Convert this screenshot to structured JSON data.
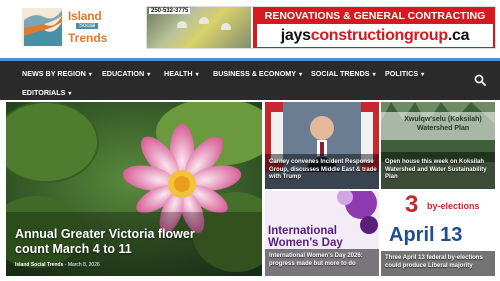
{
  "logo": {
    "word1": "Island",
    "word2": "Social",
    "word3": "Trends"
  },
  "ad": {
    "phone": "250-532-3775",
    "line1": "RENOVATIONS & GENERAL CONTRACTING",
    "domain_part1": "jays",
    "domain_part2": "constructiongroup",
    "domain_part3": ".ca"
  },
  "nav": {
    "items": [
      {
        "label": "NEWS BY REGION"
      },
      {
        "label": "EDUCATION"
      },
      {
        "label": "HEALTH"
      },
      {
        "label": "BUSINESS & ECONOMY"
      },
      {
        "label": "SOCIAL TRENDS"
      },
      {
        "label": "POLITICS"
      },
      {
        "label": "EDITORIALS"
      }
    ],
    "search_icon": "search-icon",
    "accent": "#4a90d9"
  },
  "hero": {
    "title": "Annual Greater Victoria flower count March 4 to 11",
    "author": "Island Social Trends",
    "separator": "-",
    "date": "March 8, 2026"
  },
  "cards": [
    {
      "title": "Carney convenes Incident Response Group, discusses Middle East & trade with Trump"
    },
    {
      "title": "Open house this week on Koksilah Watershed and Water Sustainability Plan",
      "image_text": "Xwulqw'selu (Koksilah) Watershed Plan"
    },
    {
      "title": "International Women's Day 2026: progress made but more to do",
      "image_text_1": "International",
      "image_text_2": "Women's Day"
    },
    {
      "title": "Three April 13 federal by-elections could produce Liberal majority",
      "image_num": "3",
      "image_by": "by-elections",
      "image_date": "April 13"
    }
  ]
}
